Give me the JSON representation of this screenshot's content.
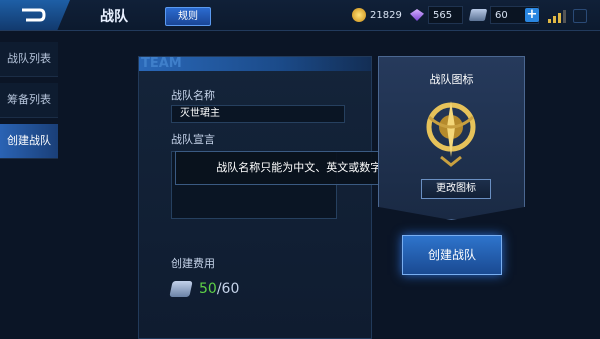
{
  "topbar": {
    "title": "战队",
    "rules_label": "规则",
    "currencies": [
      {
        "icon": "gold-coin-icon",
        "value": "21829"
      },
      {
        "icon": "diamond-icon",
        "value": "565"
      },
      {
        "icon": "ticket-icon",
        "value": "60"
      }
    ]
  },
  "sidebar": {
    "items": [
      {
        "label": "战队列表",
        "active": false
      },
      {
        "label": "筹备列表",
        "active": false
      },
      {
        "label": "创建战队",
        "active": true
      }
    ]
  },
  "form": {
    "header_watermark": "TEAM",
    "name_label": "战队名称",
    "name_value": "灭世珺主",
    "declaration_label": "战队宣言",
    "fee_label": "创建费用",
    "fee_current": "50",
    "fee_max": "/60"
  },
  "toast": {
    "message": "战队名称只能为中文、英文或数字!"
  },
  "emblem": {
    "title": "战队图标",
    "change_label": "更改图标"
  },
  "create_button": {
    "label": "创建战队"
  },
  "colors": {
    "accent": "#2a6cd0",
    "fee_current": "#5ed147"
  }
}
